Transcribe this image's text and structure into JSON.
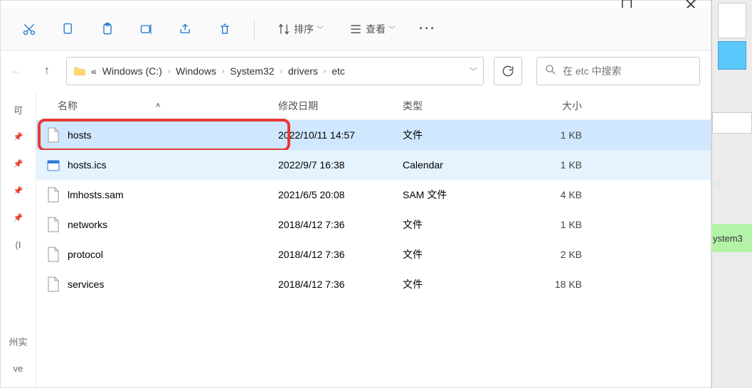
{
  "titlebar": {
    "maximize": "❐",
    "close": "✕"
  },
  "toolbar": {
    "sort_label": "排序",
    "view_label": "查看",
    "more": "···"
  },
  "breadcrumb": {
    "prefix": "«",
    "items": [
      "Windows (C:)",
      "Windows",
      "System32",
      "drivers",
      "etc"
    ]
  },
  "search": {
    "placeholder": "在 etc 中搜索"
  },
  "columns": {
    "name": "名称",
    "date": "修改日期",
    "type": "类型",
    "size": "大小"
  },
  "files": [
    {
      "name": "hosts",
      "date": "2022/10/11 14:57",
      "type": "文件",
      "size": "1 KB",
      "icon": "file",
      "selected": true,
      "highlighted": true
    },
    {
      "name": "hosts.ics",
      "date": "2022/9/7 16:38",
      "type": "Calendar",
      "size": "1 KB",
      "icon": "calendar",
      "selected": false,
      "highlighted": true
    },
    {
      "name": "lmhosts.sam",
      "date": "2021/6/5 20:08",
      "type": "SAM 文件",
      "size": "4 KB",
      "icon": "file",
      "selected": false,
      "highlighted": false
    },
    {
      "name": "networks",
      "date": "2018/4/12 7:36",
      "type": "文件",
      "size": "1 KB",
      "icon": "file",
      "selected": false,
      "highlighted": false
    },
    {
      "name": "protocol",
      "date": "2018/4/12 7:36",
      "type": "文件",
      "size": "2 KB",
      "icon": "file",
      "selected": false,
      "highlighted": false
    },
    {
      "name": "services",
      "date": "2018/4/12 7:36",
      "type": "文件",
      "size": "18 KB",
      "icon": "file",
      "selected": false,
      "highlighted": false
    }
  ],
  "sidebar": {
    "items": [
      "可",
      "",
      "",
      "",
      "",
      "(I",
      "",
      "州实",
      "ve"
    ]
  },
  "rightstrip": {
    "green_label": "ystem3"
  }
}
